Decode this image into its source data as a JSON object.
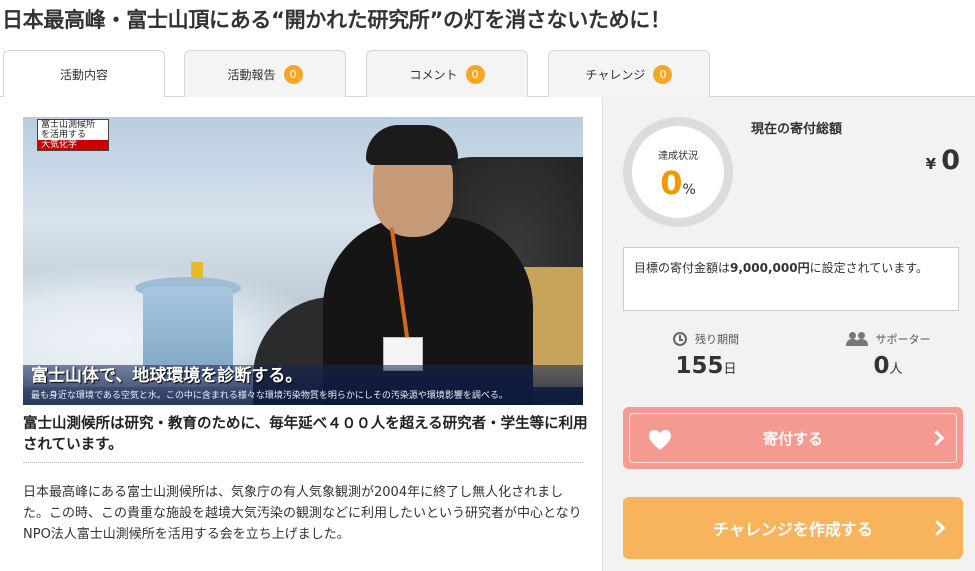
{
  "page_title": "日本最高峰・富士山頂にある“開かれた研究所”の灯を消さないために！",
  "tabs": [
    {
      "label": "活動内容",
      "active": true
    },
    {
      "label": "活動報告",
      "count": "0"
    },
    {
      "label": "コメント",
      "count": "0"
    },
    {
      "label": "チャレンジ",
      "count": "0"
    }
  ],
  "hero": {
    "tag_lines": [
      "富士山測候所",
      "を活用する",
      "大気化学"
    ],
    "caption_main": "富士山体で、地球環境を診断する。",
    "caption_sub": "最も身近な環境である空気と水。この中に含まれる様々な環境汚染物質を明らかにしその汚染源や環境影響を調べる。"
  },
  "lead": "富士山測候所は研究・教育のために、毎年延べ４００人を超える研究者・学生等に利用されています。",
  "body": "日本最高峰にある富士山測候所は、気象庁の有人気象観測が2004年に終了し無人化されました。この時、この貴重な施設を越境大気汚染の観測などに利用したいという研究者が中心となりNPO法人富士山測候所を活用する会を立ち上げました。",
  "sidebar": {
    "progress_label": "達成状況",
    "progress_value": "0",
    "progress_unit": "%",
    "total_label": "現在の寄付総額",
    "currency": "¥",
    "total_amount": "0",
    "goal_prefix": "目標の寄付金額は",
    "goal_amount": "9,000,000円",
    "goal_suffix": "に設定されています。",
    "remaining_label": "残り期間",
    "remaining_value": "155",
    "remaining_unit": "日",
    "supporters_label": "サポーター",
    "supporters_value": "0",
    "supporters_unit": "人",
    "donate_label": "寄付する",
    "challenge_label": "チャレンジを作成する"
  },
  "colors": {
    "accent": "#f39800",
    "badge": "#f5a623",
    "donate": "#f59a90",
    "challenge": "#f7b45c"
  }
}
